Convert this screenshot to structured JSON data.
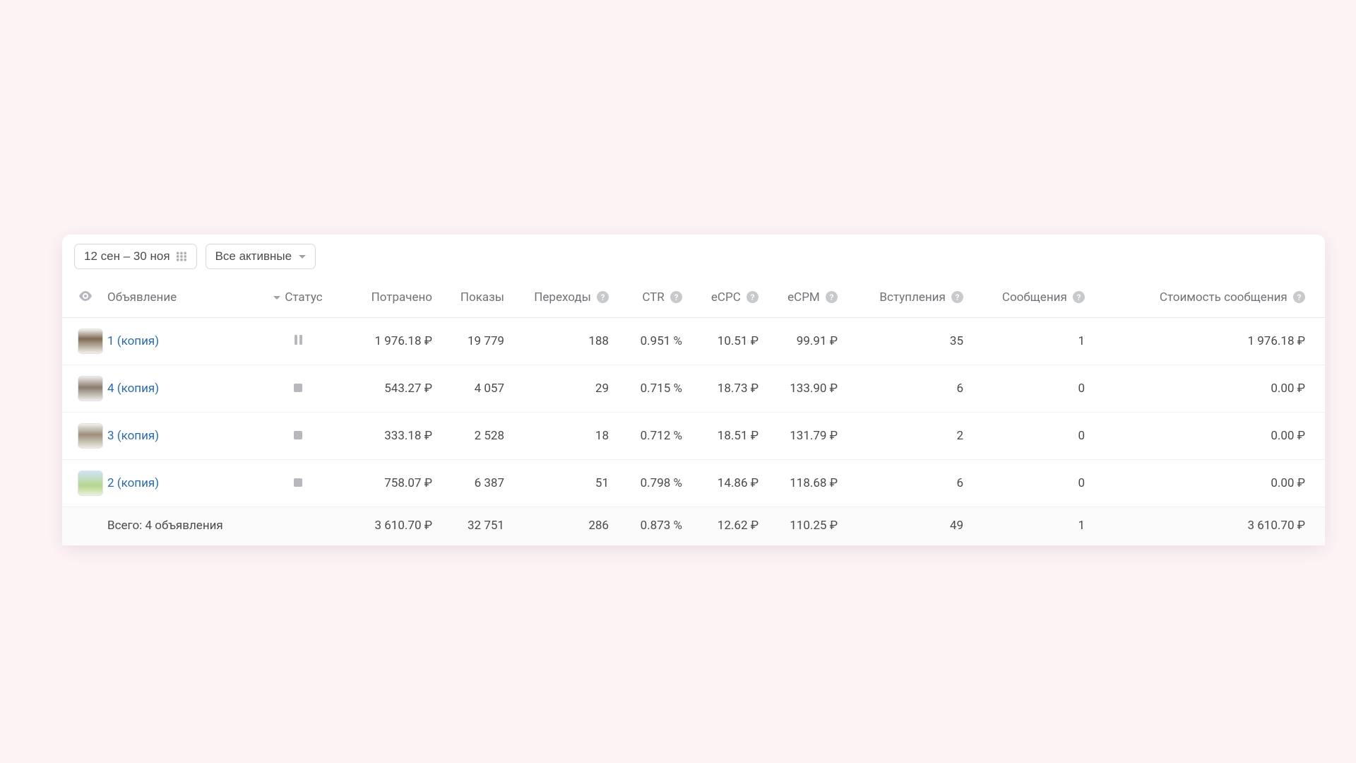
{
  "toolbar": {
    "date_range": "12 сен – 30 ноя",
    "filter_label": "Все активные"
  },
  "columns": {
    "ad": "Объявление",
    "status": "Статус",
    "spent": "Потрачено",
    "impressions": "Показы",
    "clicks": "Переходы",
    "ctr": "CTR",
    "ecpc": "eCPC",
    "ecpm": "eCPM",
    "joins": "Вступления",
    "messages": "Сообщения",
    "message_cost": "Стоимость сообщения"
  },
  "rows": [
    {
      "name": "1 (копия)",
      "status": "paused",
      "spent": "1 976.18 ₽",
      "impressions": "19 779",
      "clicks": "188",
      "ctr": "0.951 %",
      "ecpc": "10.51 ₽",
      "ecpm": "99.91 ₽",
      "joins": "35",
      "messages": "1",
      "message_cost": "1 976.18 ₽"
    },
    {
      "name": "4 (копия)",
      "status": "stopped",
      "spent": "543.27 ₽",
      "impressions": "4 057",
      "clicks": "29",
      "ctr": "0.715 %",
      "ecpc": "18.73 ₽",
      "ecpm": "133.90 ₽",
      "joins": "6",
      "messages": "0",
      "message_cost": "0.00 ₽"
    },
    {
      "name": "3 (копия)",
      "status": "stopped",
      "spent": "333.18 ₽",
      "impressions": "2 528",
      "clicks": "18",
      "ctr": "0.712 %",
      "ecpc": "18.51 ₽",
      "ecpm": "131.79 ₽",
      "joins": "2",
      "messages": "0",
      "message_cost": "0.00 ₽"
    },
    {
      "name": "2 (копия)",
      "status": "stopped",
      "spent": "758.07 ₽",
      "impressions": "6 387",
      "clicks": "51",
      "ctr": "0.798 %",
      "ecpc": "14.86 ₽",
      "ecpm": "118.68 ₽",
      "joins": "6",
      "messages": "0",
      "message_cost": "0.00 ₽"
    }
  ],
  "totals": {
    "label": "Всего: 4 объявления",
    "spent": "3 610.70 ₽",
    "impressions": "32 751",
    "clicks": "286",
    "ctr": "0.873 %",
    "ecpc": "12.62 ₽",
    "ecpm": "110.25 ₽",
    "joins": "49",
    "messages": "1",
    "message_cost": "3 610.70 ₽"
  }
}
